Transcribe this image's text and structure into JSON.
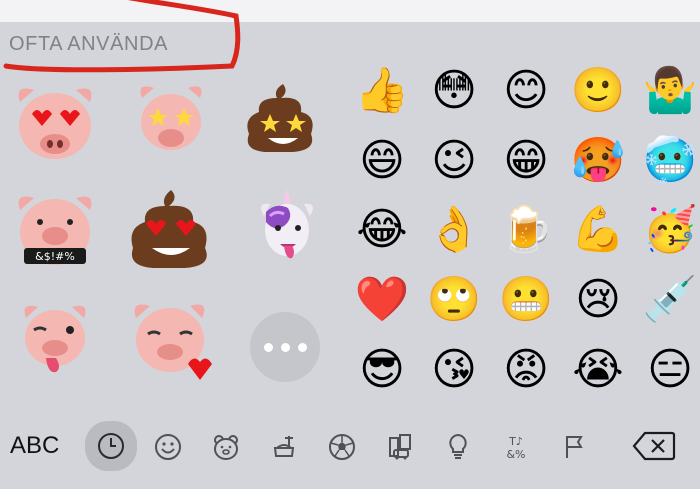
{
  "keyboard": {
    "section_title": "OFTA ANVÄNDA",
    "abc_label": "ABC",
    "emojis": [
      "👍",
      "😳",
      "😊",
      "🙂",
      "🤷‍♂️",
      "😄",
      "😉",
      "😁",
      "🥵",
      "🥶",
      "😂",
      "👌",
      "🍺",
      "💪",
      "🥳",
      "❤️",
      "🙄",
      "😬",
      "😢",
      "💉",
      "😎",
      "😘",
      "😡",
      "😭",
      "😑"
    ],
    "memoji": [
      {
        "name": "pig-heart-eyes",
        "text": ""
      },
      {
        "name": "pig-star-eyes",
        "text": ""
      },
      {
        "name": "poo-star-eyes",
        "text": ""
      },
      {
        "name": "pig-censored",
        "text": "&$!#%"
      },
      {
        "name": "poo-heart-eyes",
        "text": ""
      },
      {
        "name": "unicorn-tongue",
        "text": ""
      },
      {
        "name": "pig-wink-tongue",
        "text": ""
      },
      {
        "name": "pig-kiss-heart",
        "text": ""
      }
    ],
    "categories": [
      "clock-icon",
      "smiley-icon",
      "bear-icon",
      "food-icon",
      "soccer-ball-icon",
      "buildings-icon",
      "lightbulb-icon",
      "symbols-icon",
      "flag-icon"
    ],
    "active_category": "clock-icon",
    "symbols_icon_text": "T♪&%"
  },
  "colors": {
    "annotation": "#d8261c",
    "keyboard_bg": "#d3d5da",
    "icon": "#3a3a3c"
  }
}
